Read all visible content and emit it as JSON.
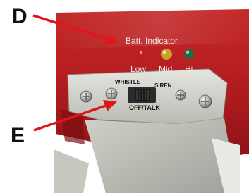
{
  "callouts": {
    "d": "D",
    "e": "E"
  },
  "battery_indicator": {
    "title": "Batt. Indicator",
    "leds": [
      {
        "label": "Low",
        "color": "#c4172b"
      },
      {
        "label": "Mid",
        "color": "#c9a12a"
      },
      {
        "label": "Hi",
        "color": "#1f6a45"
      }
    ]
  },
  "mode_switch": {
    "left_label": "WHISTLE",
    "right_label": "SIREN",
    "bottom_label": "OFF/TALK"
  },
  "colors": {
    "housing_red": "#b81f22",
    "arrow_red": "#e0161b",
    "switch_plate": "#d2d3cc"
  }
}
